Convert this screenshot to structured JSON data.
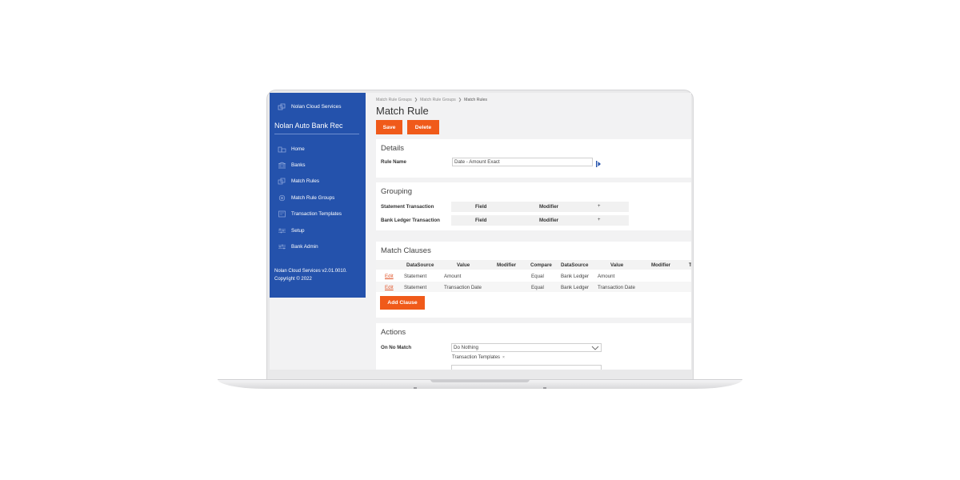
{
  "sidebar": {
    "brand": "Nolan Cloud Services",
    "app_name": "Nolan Auto Bank Rec",
    "items": [
      {
        "label": "Home",
        "icon": "home-icon"
      },
      {
        "label": "Banks",
        "icon": "bank-icon"
      },
      {
        "label": "Match Rules",
        "icon": "rules-icon"
      },
      {
        "label": "Match Rule Groups",
        "icon": "groups-icon"
      },
      {
        "label": "Transaction Templates",
        "icon": "template-icon"
      },
      {
        "label": "Setup",
        "icon": "setup-icon"
      },
      {
        "label": "Bank Admin",
        "icon": "admin-icon"
      }
    ],
    "version": "Nolan Cloud Services v2.01.0010.",
    "copyright": "Copyright © 2022"
  },
  "breadcrumb": [
    "Match Rule Groups",
    "Match Rule Groups",
    "Match Rules"
  ],
  "page_title": "Match Rule",
  "toolbar": {
    "save": "Save",
    "delete": "Delete"
  },
  "details": {
    "title": "Details",
    "rule_name_label": "Rule Name",
    "rule_name_value": "Date - Amount Exact"
  },
  "grouping": {
    "title": "Grouping",
    "rows": [
      {
        "label": "Statement Transaction",
        "field": "Field",
        "modifier": "Modifier",
        "add": "+"
      },
      {
        "label": "Bank Ledger Transaction",
        "field": "Field",
        "modifier": "Modifier",
        "add": "+"
      }
    ]
  },
  "match_clauses": {
    "title": "Match Clauses",
    "headers": [
      "DataSource",
      "Value",
      "Modifier",
      "Compare",
      "DataSource",
      "Value",
      "Modifier",
      "T"
    ],
    "rows": [
      {
        "edit": "Edit",
        "cells": [
          "Statement",
          "Amount",
          "",
          "Equal",
          "Bank Ledger",
          "Amount",
          ""
        ]
      },
      {
        "edit": "Edit",
        "cells": [
          "Statement",
          "Transaction Date",
          "",
          "Equal",
          "Bank Ledger",
          "Transaction Date",
          ""
        ]
      }
    ],
    "add_clause": "Add Clause"
  },
  "actions": {
    "title": "Actions",
    "on_no_match_label": "On No Match",
    "on_no_match_value": "Do Nothing",
    "template_chip": "Transaction Templates",
    "chip_remove": "×"
  },
  "colors": {
    "sidebar": "#2452ac",
    "accent": "#f05a1a",
    "link": "#e0552a"
  }
}
